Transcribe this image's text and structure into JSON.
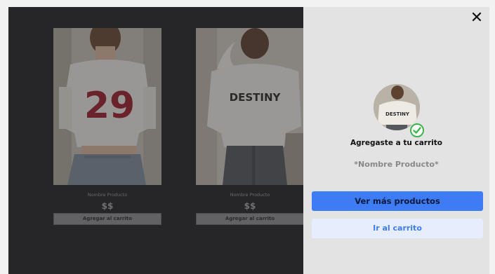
{
  "products": [
    {
      "name": "Nombre Producto",
      "price": "$$",
      "add_label": "Agregar al carrito",
      "shirt_text": "29"
    },
    {
      "name": "Nombre Producto",
      "price": "$$",
      "add_label": "Agregar al carrito",
      "shirt_text": "DESTINY"
    }
  ],
  "cart_panel": {
    "close_icon": "close-icon",
    "title": "Agregaste a tu carrito",
    "product_name": "*Nombre Producto*",
    "primary_label": "Ver más productos",
    "secondary_label": "Ir al carrito",
    "thumb_text": "DESTINY"
  },
  "colors": {
    "accent": "#3d7cf5",
    "success": "#3cb54a",
    "panel": "#e3e3e3",
    "backdrop": "#262629"
  }
}
